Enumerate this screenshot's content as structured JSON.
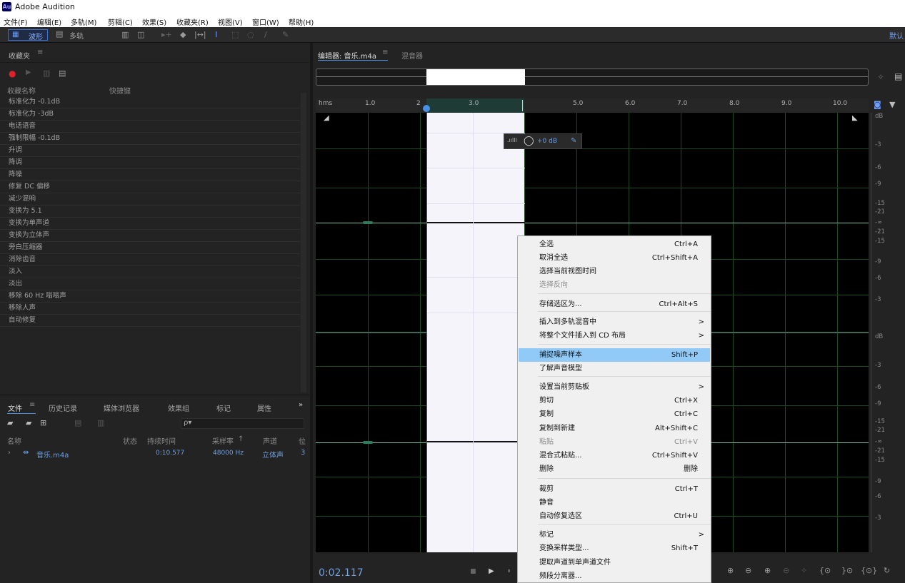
{
  "app": {
    "logo": "Au",
    "title": "Adobe Audition"
  },
  "menu": [
    "文件(F)",
    "编辑(E)",
    "多轨(M)",
    "剪辑(C)",
    "效果(S)",
    "收藏夹(R)",
    "视图(V)",
    "窗口(W)",
    "帮助(H)"
  ],
  "toolbar": {
    "waveform": "波形",
    "multitrack": "多轨",
    "workspace": "默认"
  },
  "favorites": {
    "panel_title": "收藏夹",
    "col_name": "收藏名称",
    "col_shortcut": "快捷键",
    "items": [
      "标准化为 -0.1dB",
      "标准化为 -3dB",
      "电话语音",
      "强制限幅 -0.1dB",
      "升调",
      "降调",
      "降噪",
      "修复 DC 偏移",
      "减少混响",
      "变换为 5.1",
      "变换为单声道",
      "变换为立体声",
      "旁白压缩器",
      "消除齿音",
      "淡入",
      "淡出",
      "移除 60 Hz 嗡嗡声",
      "移除人声",
      "自动修复"
    ]
  },
  "files": {
    "tabs": [
      "文件",
      "历史记录",
      "媒体浏览器",
      "效果组",
      "标记",
      "属性"
    ],
    "search_icon": "ρ▾",
    "columns": [
      "名称",
      "状态",
      "持续时间",
      "采样率",
      "声道",
      "位"
    ],
    "row": {
      "name": "音乐.m4a",
      "duration": "0:10.577",
      "sample_rate": "48000 Hz",
      "channels": "立体声",
      "bits": "3"
    }
  },
  "editor": {
    "tab_editor": "编辑器: 音乐.m4a",
    "tab_mixer": "混音器",
    "ruler_unit": "hms",
    "ruler_ticks": [
      "1.0",
      "2",
      "3.0",
      "5.0",
      "6.0",
      "7.0",
      "8.0",
      "9.0",
      "10.0"
    ],
    "hud_gain": "+0 dB",
    "time": "0:02.117",
    "db_top": [
      "dB",
      "-3",
      "-6",
      "-9",
      "-15",
      "-21",
      "-∞",
      "-21",
      "-15",
      "-9",
      "-6",
      "-3"
    ],
    "db_bottom": [
      "dB",
      "-3",
      "-6",
      "-9",
      "-15",
      "-21",
      "-∞",
      "-21",
      "-15",
      "-9",
      "-6",
      "-3"
    ]
  },
  "context_menu": [
    {
      "label": "全选",
      "shortcut": "Ctrl+A"
    },
    {
      "label": "取消全选",
      "shortcut": "Ctrl+Shift+A"
    },
    {
      "label": "选择当前视图时间",
      "shortcut": ""
    },
    {
      "label": "选择反向",
      "shortcut": "",
      "disabled": true
    },
    {
      "label": "存储选区为...",
      "shortcut": "Ctrl+Alt+S"
    },
    {
      "label": "插入到多轨混音中",
      "arrow": ">"
    },
    {
      "label": "将整个文件插入到 CD 布局",
      "arrow": ">"
    },
    {
      "label": "捕捉噪声样本",
      "shortcut": "Shift+P",
      "highlight": true
    },
    {
      "label": "了解声音模型",
      "shortcut": ""
    },
    {
      "label": "设置当前剪贴板",
      "arrow": ">"
    },
    {
      "label": "剪切",
      "shortcut": "Ctrl+X"
    },
    {
      "label": "复制",
      "shortcut": "Ctrl+C"
    },
    {
      "label": "复制到新建",
      "shortcut": "Alt+Shift+C"
    },
    {
      "label": "粘贴",
      "shortcut": "Ctrl+V",
      "disabled": true
    },
    {
      "label": "混合式粘贴...",
      "shortcut": "Ctrl+Shift+V"
    },
    {
      "label": "删除",
      "shortcut": "删除"
    },
    {
      "label": "裁剪",
      "shortcut": "Ctrl+T"
    },
    {
      "label": "静音",
      "shortcut": ""
    },
    {
      "label": "自动修复选区",
      "shortcut": "Ctrl+U"
    },
    {
      "label": "标记",
      "arrow": ">"
    },
    {
      "label": "变换采样类型...",
      "shortcut": "Shift+T"
    },
    {
      "label": "提取声道到单声道文件",
      "shortcut": ""
    },
    {
      "label": "频段分离器...",
      "shortcut": ""
    }
  ],
  "colors": {
    "accent": "#4a8ee6",
    "timecode": "#6f9ee0",
    "selection": "#f4f4fa",
    "highlight": "#91c9f7",
    "record": "#e0202a"
  }
}
